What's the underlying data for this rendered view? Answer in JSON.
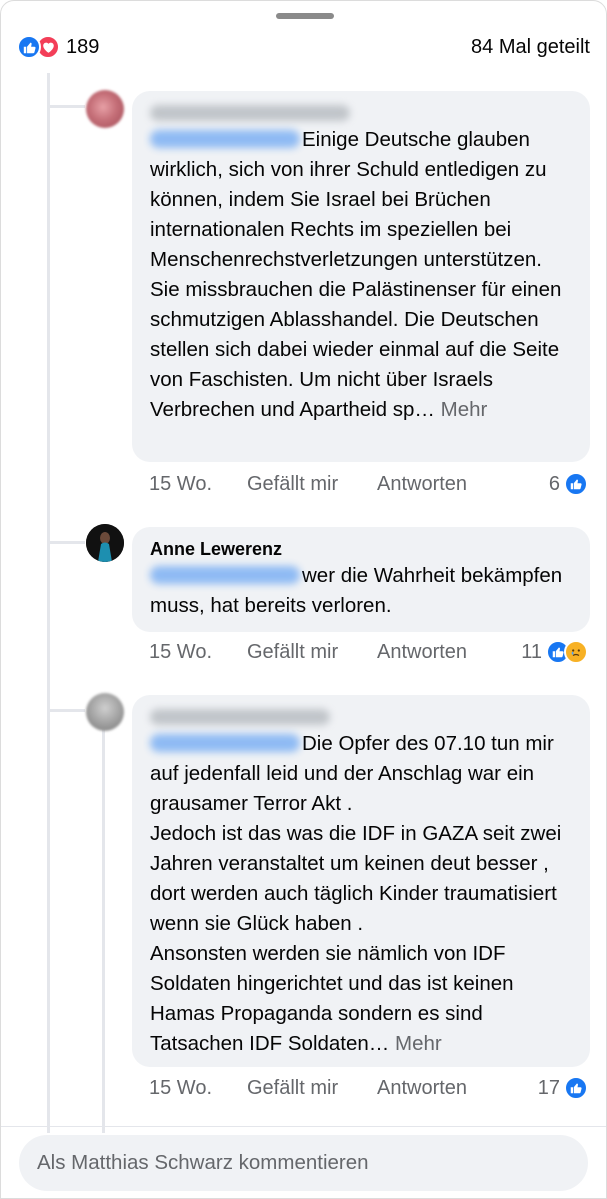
{
  "header": {
    "reaction_count": "189",
    "shares": "84 Mal geteilt"
  },
  "comments": [
    {
      "author": "",
      "text": "Einige Deutsche glauben wirklich, sich von ihrer Schuld entledigen zu können, indem Sie Israel bei Brüchen internationalen Rechts im speziellen bei Menschenrechstverletzungen unterstützen. Sie missbrauchen die Palästinenser für einen schmutzigen Ablasshandel. Die Deutschen stellen sich dabei wieder einmal auf die Seite von Faschisten. Um nicht über Israels Verbrechen und Apartheid sp…",
      "more": "Mehr",
      "time": "15 Wo.",
      "like": "Gefällt mir",
      "reply": "Antworten",
      "reactions": "6"
    },
    {
      "author": "Anne Lewerenz",
      "text": "wer die Wahrheit bekämpfen muss, hat bereits verloren.",
      "more": "",
      "time": "15 Wo.",
      "like": "Gefällt mir",
      "reply": "Antworten",
      "reactions": "11"
    },
    {
      "author": "",
      "text": "Die Opfer des 07.10 tun mir auf jedenfall leid und der Anschlag war ein grausamer Terror Akt .\nJedoch ist das was die IDF in GAZA seit zwei Jahren veranstaltet um keinen deut besser , dort werden auch täglich Kinder traumatisiert wenn sie Glück haben .\nAnsonsten werden sie nämlich von IDF Soldaten hingerichtet und das ist keinen Hamas Propaganda sondern es sind Tatsachen IDF Soldaten…",
      "more": "Mehr",
      "time": "15 Wo.",
      "like": "Gefällt mir",
      "reply": "Antworten",
      "reactions": "17"
    }
  ],
  "compose": {
    "placeholder": "Als Matthias Schwarz kommentieren"
  },
  "colors": {
    "accent": "#1877f2",
    "love": "#f33e58",
    "bubble": "#f0f2f5",
    "meta_text": "#65676b"
  },
  "icons": [
    "like-icon",
    "love-icon",
    "sad-icon"
  ]
}
